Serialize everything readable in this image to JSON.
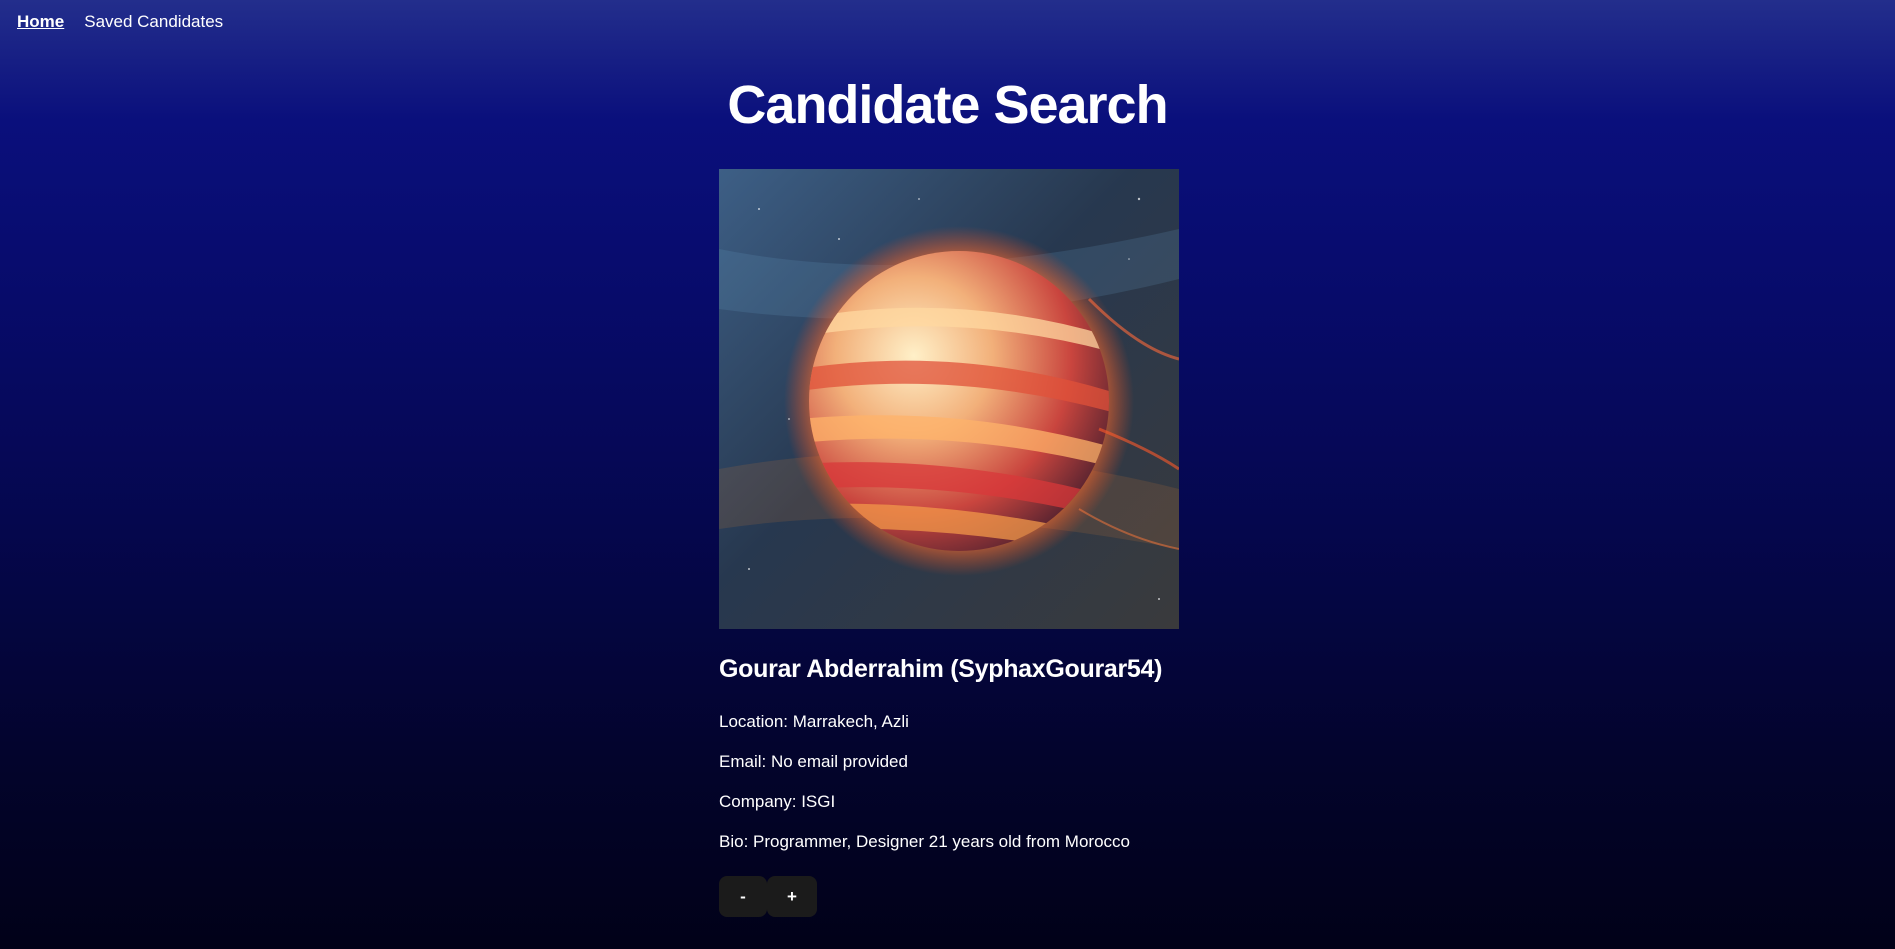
{
  "nav": {
    "home_label": "Home",
    "saved_label": "Saved Candidates"
  },
  "page": {
    "title": "Candidate Search"
  },
  "candidate": {
    "name_line": "Gourar Abderrahim (SyphaxGourar54)",
    "location": "Location: Marrakech, Azli",
    "email": "Email: No email provided",
    "company": "Company: ISGI",
    "bio": "Bio: Programmer, Designer 21 years old from Morocco",
    "avatar_icon": "planet-avatar-image"
  },
  "actions": {
    "reject_label": "-",
    "accept_label": "+"
  },
  "colors": {
    "button_bg": "#1b1b1b",
    "text": "#ffffff",
    "bg_top": "#232e8c",
    "bg_bottom": "#010118"
  }
}
